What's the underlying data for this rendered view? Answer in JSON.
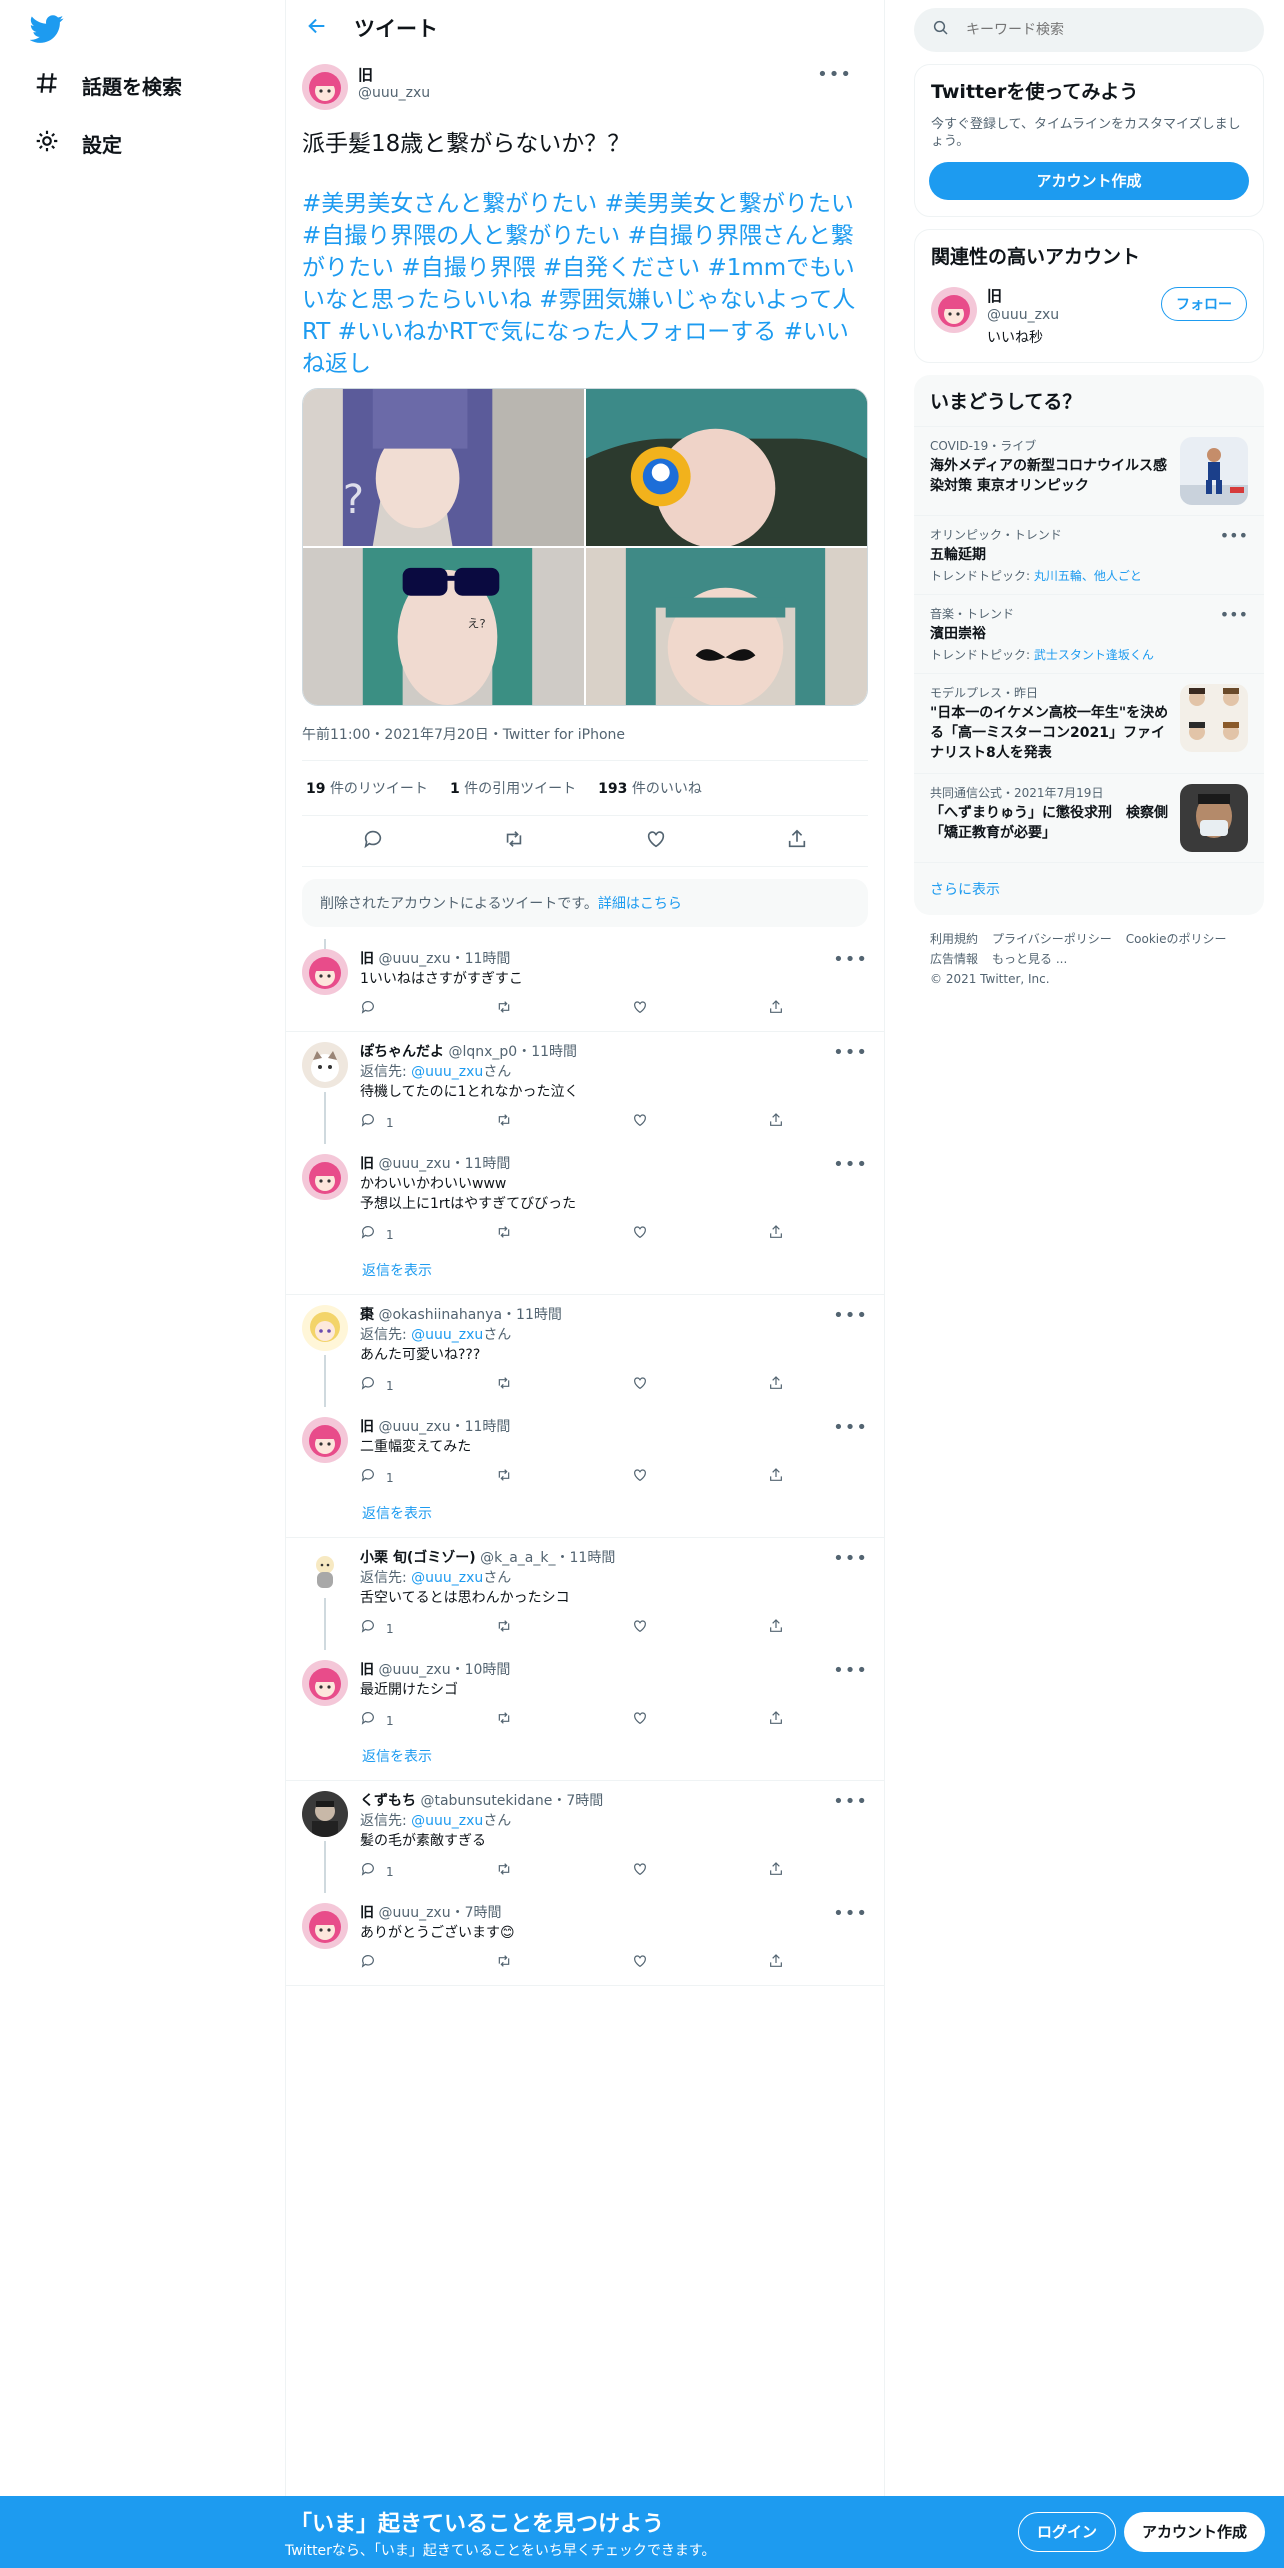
{
  "nav": {
    "explore_label": "話題を検索",
    "settings_label": "設定"
  },
  "header": {
    "title": "ツイート"
  },
  "tweet": {
    "name": "旧",
    "handle": "@uuu_zxu",
    "text": "派手髪18歳と繋がらないか？？",
    "hashtags": "#美男美女さんと繋がりたい #美男美女と繋がりたい #自撮り界隈の人と繋がりたい #自撮り界隈さんと繋がりたい #自撮り界隈 #自発ください #1mmでもいいなと思ったらいいね #雰囲気嫌いじゃないよって人RT #いいねかRTで気になった人フォローする #いいね返し",
    "timestamp": "午前11:00・2021年7月20日・Twitter for iPhone",
    "photo_caption": "え?",
    "retweets": "19",
    "retweets_label": "件のリツイート",
    "quotes": "1",
    "quotes_label": "件の引用ツイート",
    "likes": "193",
    "likes_label": "件のいいね"
  },
  "deleted_notice": {
    "text": "削除されたアカウントによるツイートです。",
    "link": "詳細はこちら"
  },
  "replies": [
    {
      "name": "旧",
      "handle": "@uuu_zxu",
      "time": "11時間",
      "reply_to": "",
      "text": "1いいねはさすがすぎすこ",
      "count": "",
      "avatar": "pink"
    },
    {
      "name": "ぽちゃんだよ",
      "handle": "@lqnx_p0",
      "time": "11時間",
      "reply_to": "@uuu_zxu",
      "text": "待機してたのに1とれなかった泣く",
      "count": "1",
      "avatar": "cat"
    },
    {
      "name": "旧",
      "handle": "@uuu_zxu",
      "time": "11時間",
      "reply_to": "",
      "text": "かわいいかわいいwww\n予想以上に1rtはやすぎてびびった",
      "count": "1",
      "avatar": "pink"
    },
    {
      "name": "棗",
      "handle": "@okashiinahanya",
      "time": "11時間",
      "reply_to": "@uuu_zxu",
      "text": "あんた可愛いね???",
      "count": "1",
      "avatar": "blonde"
    },
    {
      "name": "旧",
      "handle": "@uuu_zxu",
      "time": "11時間",
      "reply_to": "",
      "text": "二重幅変えてみた",
      "count": "1",
      "avatar": "pink"
    },
    {
      "name": "小栗 旬(ゴミゾー)",
      "handle": "@k_a_a_k_",
      "time": "11時間",
      "reply_to": "@uuu_zxu",
      "text": "舌空いてるとは思わんかったシコ",
      "count": "1",
      "avatar": "chibi"
    },
    {
      "name": "旧",
      "handle": "@uuu_zxu",
      "time": "10時間",
      "reply_to": "",
      "text": "最近開けたシゴ",
      "count": "1",
      "avatar": "pink"
    },
    {
      "name": "くずもち",
      "handle": "@tabunsutekidane",
      "time": "7時間",
      "reply_to": "@uuu_zxu",
      "text": "髪の毛が素敵すぎる",
      "count": "1",
      "avatar": "dark"
    },
    {
      "name": "旧",
      "handle": "@uuu_zxu",
      "time": "7時間",
      "reply_to": "",
      "text": "ありがとうございます😊",
      "count": "",
      "avatar": "pink"
    }
  ],
  "reply_to_prefix": "返信先: ",
  "reply_to_suffix": "さん",
  "show_replies_label": "返信を表示",
  "search": {
    "placeholder": "キーワード検索"
  },
  "signup_card": {
    "title": "Twitterを使ってみよう",
    "desc": "今すぐ登録して、タイムラインをカスタマイズしましょう。",
    "button": "アカウント作成"
  },
  "related_card": {
    "title": "関連性の高いアカウント",
    "name": "旧",
    "handle": "@uuu_zxu",
    "bio": "いいね秒",
    "follow": "フォロー"
  },
  "trends_card": {
    "title": "いまどうしてる？",
    "items": [
      {
        "meta": "COVID-19・ライブ",
        "title": "海外メディアの新型コロナウイルス感染対策 東京オリンピック",
        "topic_label": "",
        "topic": "",
        "thumb": "sport"
      },
      {
        "meta": "オリンピック・トレンド",
        "title": "五輪延期",
        "topic_label": "トレンドトピック: ",
        "topic": "丸川五輪、他人ごと",
        "thumb": ""
      },
      {
        "meta": "音楽・トレンド",
        "title": "濱田崇裕",
        "topic_label": "トレンドトピック: ",
        "topic": "武士スタント逢坂くん",
        "thumb": ""
      },
      {
        "meta": "モデルプレス・昨日",
        "title": "\"日本一のイケメン高校一年生\"を決める「高一ミスターコン2021」ファイナリスト8人を発表",
        "topic_label": "",
        "topic": "",
        "thumb": "grid"
      },
      {
        "meta": "共同通信公式・2021年7月19日",
        "title": "「へずまりゅう」に懲役求刑　検察側「矯正教育が必要」",
        "topic_label": "",
        "topic": "",
        "thumb": "face"
      }
    ],
    "show_more": "さらに表示"
  },
  "footer": {
    "links": [
      "利用規約",
      "プライバシーポリシー",
      "Cookieのポリシー",
      "広告情報",
      "もっと見る ..."
    ],
    "copyright": "© 2021 Twitter, Inc."
  },
  "bottom_bar": {
    "title": "「いま」起きていることを見つけよう",
    "subtitle": "Twitterなら、「いま」起きていることをいち早くチェックできます。",
    "login": "ログイン",
    "signup": "アカウント作成"
  },
  "colors": {
    "accent": "#1d9bf0",
    "text": "#0f1419",
    "muted": "#536471"
  }
}
